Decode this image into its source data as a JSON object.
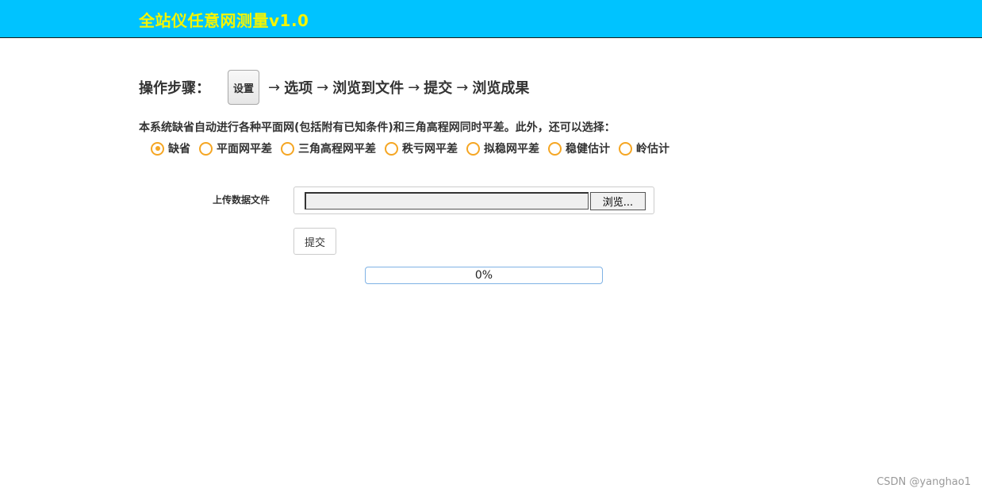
{
  "header": {
    "title": "全站仪任意网测量v1.0",
    "background": "#00c3ff",
    "title_color": "#f5f500"
  },
  "steps": {
    "label": "操作步骤：",
    "settings_button": "设置",
    "arrow": "→",
    "items": [
      "选项",
      "浏览到文件",
      "提交",
      "浏览成果"
    ]
  },
  "description": "本系统缺省自动进行各种平面网(包括附有已知条件)和三角高程网同时平差。此外，还可以选择：",
  "options": {
    "items": [
      "缺省",
      "平面网平差",
      "三角高程网平差",
      "秩亏网平差",
      "拟稳网平差",
      "稳健估计",
      "岭估计"
    ],
    "selected_index": 0,
    "accent": "#f5a623"
  },
  "upload": {
    "label": "上传数据文件",
    "file_value": "",
    "browse_label": "浏览..."
  },
  "submit_label": "提交",
  "progress": {
    "value": 0,
    "text": "0%"
  },
  "watermark": "CSDN @yanghao1"
}
